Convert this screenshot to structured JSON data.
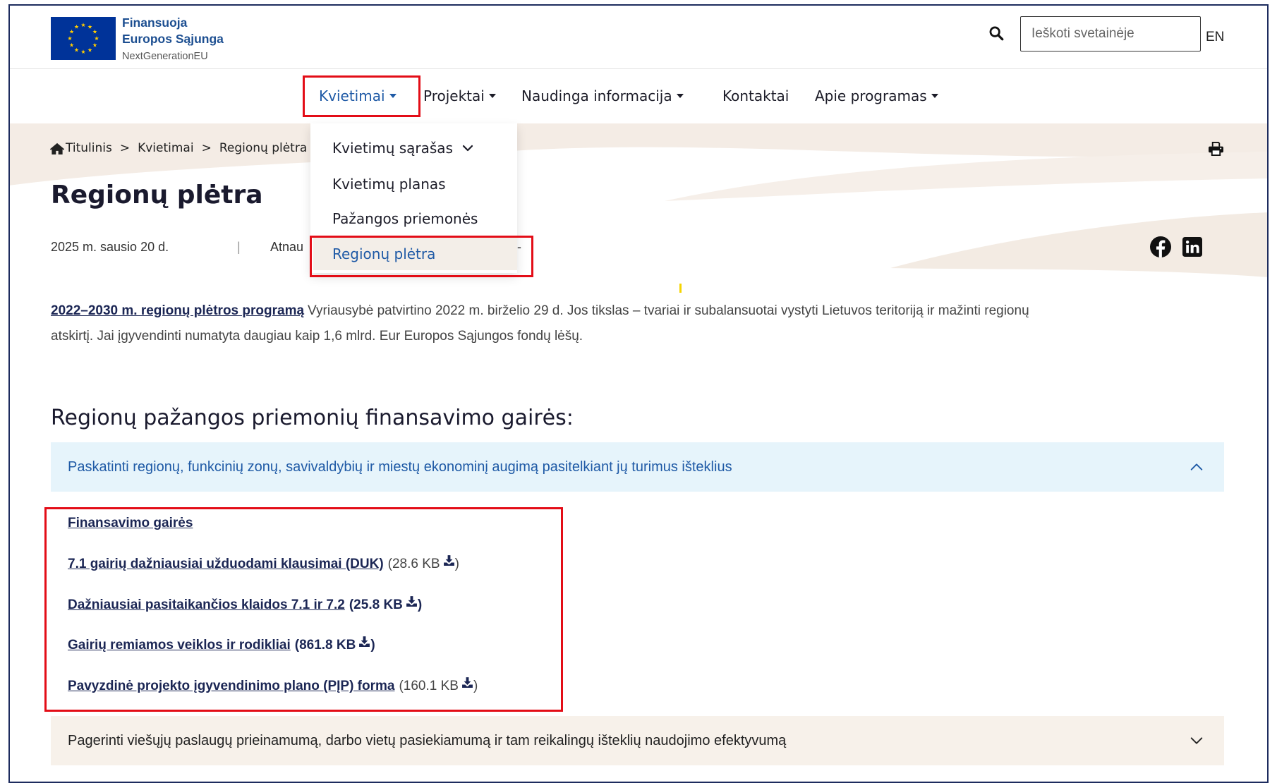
{
  "header": {
    "logo": {
      "line1": "Finansuoja",
      "line2": "Europos Sąjunga",
      "line3": "NextGenerationEU",
      "icon": "eu-flag-icon"
    },
    "search": {
      "placeholder": "Ieškoti svetainėje",
      "value": "",
      "icon": "search-icon"
    },
    "language": "EN"
  },
  "nav": {
    "items": [
      {
        "label": "Kvietimai",
        "has_dropdown": true,
        "active": true
      },
      {
        "label": "Projektai",
        "has_dropdown": true
      },
      {
        "label": "Naudinga informacija",
        "has_dropdown": true
      },
      {
        "label": "Kontaktai",
        "has_dropdown": false
      },
      {
        "label": "Apie programas",
        "has_dropdown": true
      }
    ]
  },
  "dropdown": {
    "open_under": "Kvietimai",
    "items": [
      {
        "label": "Kvietimų sąrašas",
        "has_submenu": true,
        "icon": "chevron-down-icon"
      },
      {
        "label": "Kvietimų planas"
      },
      {
        "label": "Pažangos priemonės"
      },
      {
        "label": "Regionų plėtra",
        "active": true
      }
    ]
  },
  "breadcrumb": {
    "home_icon": "home-icon",
    "items": [
      "Titulinis",
      "Kvietimai",
      "Regionų plėtra"
    ],
    "separator": ">"
  },
  "page": {
    "title": "Regionų plėtra",
    "date": "2025 m. sausio 20 d.",
    "divider": "|",
    "updated_label": "Atnau",
    "updated_tail": "-",
    "print_icon": "print-icon",
    "share_icons": [
      "facebook-icon",
      "linkedin-icon"
    ]
  },
  "intro": {
    "link": "2022–2030 m. regionų plėtros programą",
    "line1": "Vyriausybė patvirtino 2022 m. birželio 29 d. Jos tikslas – tvariai ir subalansuotai vystyti Lietuvos teritoriją ir mažinti regionų",
    "line2": "atskirtį. Jai įgyvendinti numatyta daugiau kaip 1,6 mlrd. Eur Europos Sąjungos fondų lėšų."
  },
  "section": {
    "heading": "Regionų pažangos priemonių finansavimo gairės:"
  },
  "accordions": [
    {
      "title": "Paskatinti regionų, funkcinių zonų, savivaldybių ir miestų ekonominį augimą pasitelkiant jų turimus išteklius",
      "expanded": true,
      "icon": "chevron-up-icon",
      "links": [
        {
          "label": "Finansavimo gairės"
        },
        {
          "label": "7.1 gairių dažniausiai užduodami klausimai (DUK)",
          "size": "(28.6 KB",
          "close": ")",
          "size_bold": false,
          "icon": "download-icon"
        },
        {
          "label": "Dažniausiai pasitaikančios klaidos 7.1 ir 7.2",
          "size": "(25.8 KB",
          "close": ")",
          "size_bold": true,
          "icon": "download-icon"
        },
        {
          "label": "Gairių remiamos veiklos ir rodikliai",
          "size": "(861.8 KB",
          "close": ")",
          "size_bold": true,
          "icon": "download-icon"
        },
        {
          "label": "Pavyzdinė projekto įgyvendinimo plano (PĮP) forma",
          "size": "(160.1 KB",
          "close": ")",
          "size_bold": false,
          "icon": "download-icon"
        }
      ]
    },
    {
      "title": "Pagerinti viešųjų paslaugų prieinamumą, darbo vietų pasiekiamumą ir tam reikalingų išteklių naudojimo efektyvumą",
      "expanded": false,
      "icon": "chevron-down-icon"
    }
  ],
  "colors": {
    "brand_navy": "#1b2654",
    "link_blue": "#1f5aa6",
    "highlight_red": "#e30d17",
    "accordion_active_bg": "#e6f4fb",
    "accordion_bg": "#f7f1ea",
    "hero_beige": "#f4ece5",
    "eu_blue": "#003399",
    "eu_yellow": "#ffcc00",
    "frame": "#1d2c5e"
  }
}
